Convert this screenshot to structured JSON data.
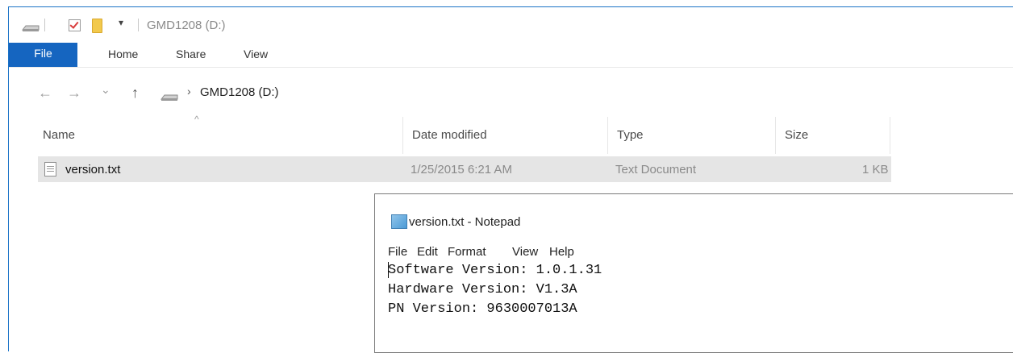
{
  "explorer": {
    "title": "GMD1208 (D:)",
    "quick_access_dropdown": "▾",
    "ribbon_tabs": [
      "File",
      "Home",
      "Share",
      "View"
    ],
    "address": {
      "back": "←",
      "forward": "→",
      "recent": "⌄",
      "up": "↑",
      "chevron": "›",
      "path": "GMD1208 (D:)"
    },
    "sort_indicator": "^",
    "columns": [
      "Name",
      "Date modified",
      "Type",
      "Size"
    ],
    "files": [
      {
        "name": "version.txt",
        "date": "1/25/2015 6:21 AM",
        "type": "Text Document",
        "size": "1 KB"
      }
    ]
  },
  "notepad": {
    "title": "version.txt - Notepad",
    "menu": [
      "File",
      "Edit",
      "Format",
      "View",
      "Help"
    ],
    "lines": [
      "Software Version: 1.0.1.31",
      "Hardware Version: V1.3A",
      "PN Version: 9630007013A"
    ]
  },
  "colors": {
    "accent": "#1565c0",
    "selection": "#e5e5e5"
  }
}
